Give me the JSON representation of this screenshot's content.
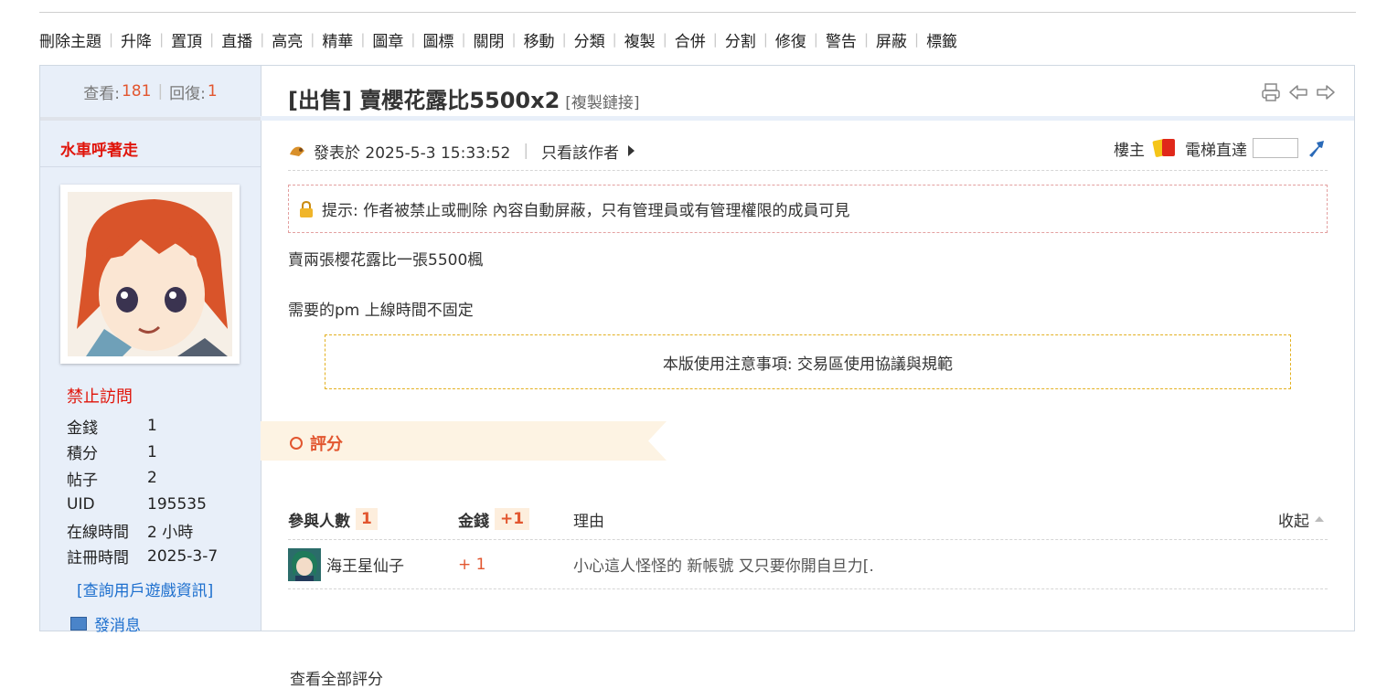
{
  "mod_actions": [
    "刪除主題",
    "升降",
    "置頂",
    "直播",
    "高亮",
    "精華",
    "圖章",
    "圖標",
    "關閉",
    "移動",
    "分類",
    "複製",
    "合併",
    "分割",
    "修復",
    "警告",
    "屏蔽",
    "標籤"
  ],
  "stats": {
    "views_label": "查看:",
    "views": "181",
    "replies_label": "回復:",
    "replies": "1"
  },
  "author": {
    "name": "水車呼著走",
    "group": "禁止訪問",
    "info": [
      {
        "k": "金錢",
        "v": "1"
      },
      {
        "k": "積分",
        "v": "1"
      },
      {
        "k": "帖子",
        "v": "2"
      },
      {
        "k": "UID",
        "v": "195535"
      },
      {
        "k": "在線時間",
        "v": "2 小時"
      },
      {
        "k": "註冊時間",
        "v": "2025-3-7"
      }
    ],
    "game_link": "[查詢用戶遊戲資訊]",
    "pm_label": "發消息"
  },
  "thread": {
    "title": "[出售] 賣櫻花露比5500x2",
    "copy_link": "[複製鏈接]"
  },
  "post": {
    "posted_at": "發表於 2025-5-3 15:33:52",
    "only_author": "只看該作者",
    "floor": "樓主",
    "jump_label": "電梯直達",
    "notice": "提示: 作者被禁止或刪除 內容自動屏蔽，只有管理員或有管理權限的成員可見",
    "body": [
      "賣兩張櫻花露比一張5500楓",
      "需要的pm 上線時間不固定"
    ],
    "rules": "本版使用注意事項: 交易區使用協議與規範"
  },
  "rating": {
    "header": "評分",
    "participants_label": "參與人數",
    "participants": "1",
    "money_label": "金錢",
    "money_total": "+1",
    "reason_label": "理由",
    "collapse": "收起",
    "rows": [
      {
        "user": "海王星仙子",
        "amount": "+ 1",
        "reason": "小心這人怪怪的 新帳號 又只要你開自旦力[."
      }
    ],
    "view_all": "查看全部評分"
  },
  "colors": {
    "accent": "#e2562f",
    "link": "#1d6fce",
    "banned": "#e0140a",
    "side_bg": "#e8eff9"
  }
}
